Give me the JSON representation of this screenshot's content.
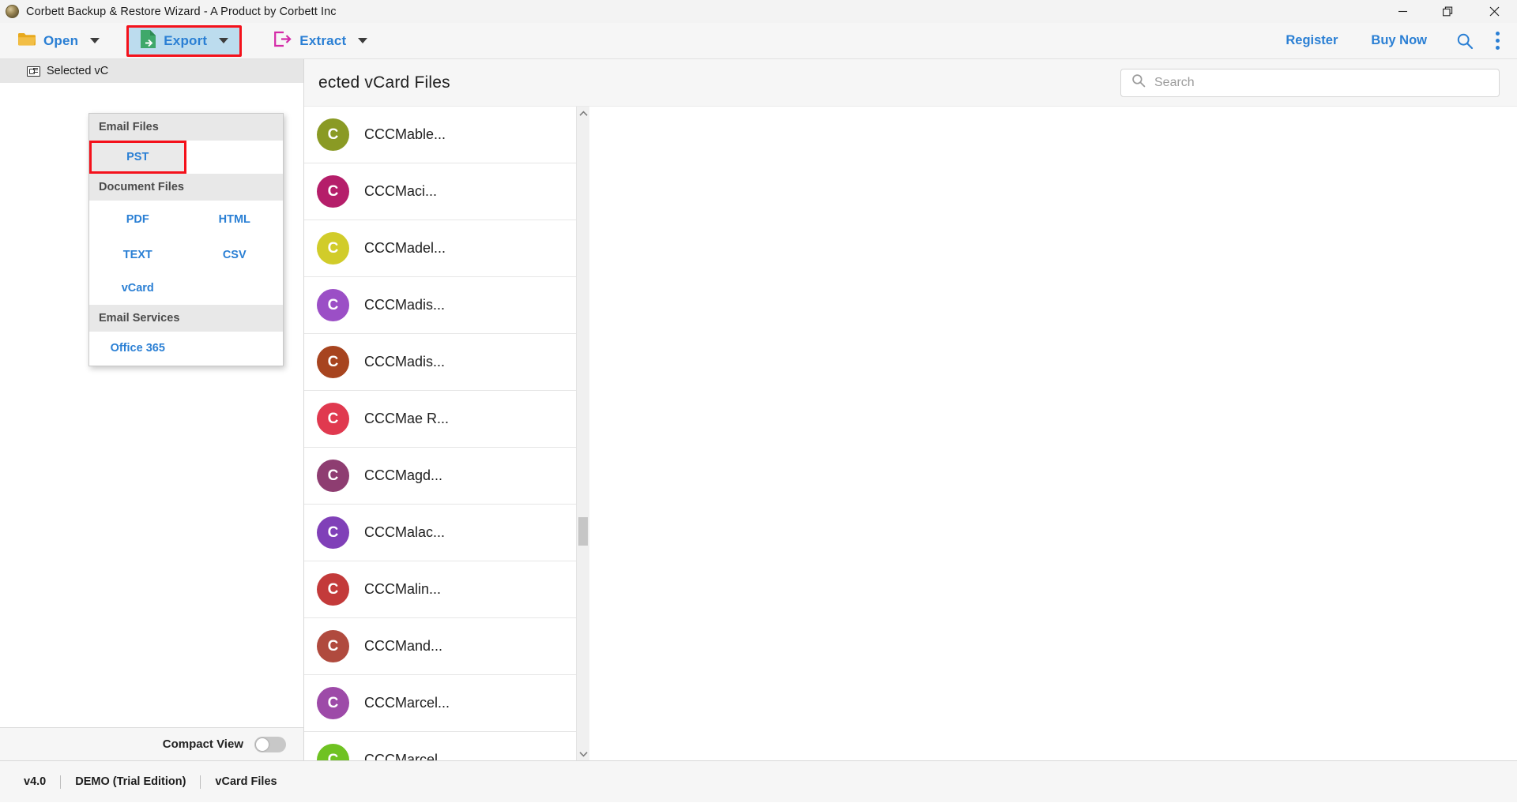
{
  "window": {
    "title": "Corbett Backup & Restore Wizard - A Product by Corbett Inc",
    "app_icon": "app-logo-icon",
    "minimize_label": "—",
    "restore_label": "restore-icon",
    "close_label": "✕"
  },
  "toolbar": {
    "open_label": "Open",
    "export_label": "Export",
    "extract_label": "Extract",
    "register_label": "Register",
    "buy_now_label": "Buy Now",
    "search_icon": "search-icon",
    "more_icon": "kebab-menu-icon",
    "accent_color": "#2a7fd4",
    "export_highlight_color": "#f4111b",
    "export_background_color": "#bcdcee"
  },
  "export_menu": {
    "sections": [
      {
        "title": "Email Files",
        "items": [
          {
            "label": "PST",
            "highlighted": true
          }
        ]
      },
      {
        "title": "Document Files",
        "items": [
          {
            "label": "PDF",
            "highlighted": false
          },
          {
            "label": "HTML",
            "highlighted": false
          },
          {
            "label": "TEXT",
            "highlighted": false
          },
          {
            "label": "CSV",
            "highlighted": false
          },
          {
            "label": "vCard",
            "highlighted": false
          }
        ]
      },
      {
        "title": "Email Services",
        "items": [
          {
            "label": "Office 365",
            "highlighted": false
          }
        ]
      }
    ],
    "section_titles": {
      "email_files": "Email Files",
      "document_files": "Document Files",
      "email_services": "Email Services"
    },
    "labels": {
      "pst": "PST",
      "pdf": "PDF",
      "html": "HTML",
      "text": "TEXT",
      "csv": "CSV",
      "vcard": "vCard",
      "office365": "Office 365"
    }
  },
  "sidebar": {
    "tab_label": "Selected vC",
    "tab_icon": "contact-card-icon",
    "compact_view_label": "Compact View",
    "compact_view_enabled": false
  },
  "main": {
    "header_title": "ected vCard Files",
    "search": {
      "placeholder": "Search",
      "value": "",
      "icon": "search-icon"
    },
    "contacts": [
      {
        "name": "CCCMable...",
        "initial": "C",
        "color": "#8a9a24"
      },
      {
        "name": "CCCMaci...",
        "initial": "C",
        "color": "#b51e6a"
      },
      {
        "name": "CCCMadel...",
        "initial": "C",
        "color": "#d1cc2a"
      },
      {
        "name": "CCCMadis...",
        "initial": "C",
        "color": "#9b4fc6"
      },
      {
        "name": "CCCMadis...",
        "initial": "C",
        "color": "#a7441f"
      },
      {
        "name": "CCCMae R...",
        "initial": "C",
        "color": "#e0394f"
      },
      {
        "name": "CCCMagd...",
        "initial": "C",
        "color": "#8e3d71"
      },
      {
        "name": "CCCMalac...",
        "initial": "C",
        "color": "#8040b8"
      },
      {
        "name": "CCCMalin...",
        "initial": "C",
        "color": "#c33a3a"
      },
      {
        "name": "CCCMand...",
        "initial": "C",
        "color": "#b04a3e"
      },
      {
        "name": "CCCMarcel...",
        "initial": "C",
        "color": "#9d4aa8"
      },
      {
        "name": "CCCMarcel...",
        "initial": "C",
        "color": "#6fc222"
      }
    ],
    "scrollbar": {
      "up_arrow": "chevron-up-icon",
      "down_arrow": "chevron-down-icon"
    }
  },
  "statusbar": {
    "version": "v4.0",
    "edition": "DEMO (Trial Edition)",
    "file_type": "vCard Files"
  }
}
